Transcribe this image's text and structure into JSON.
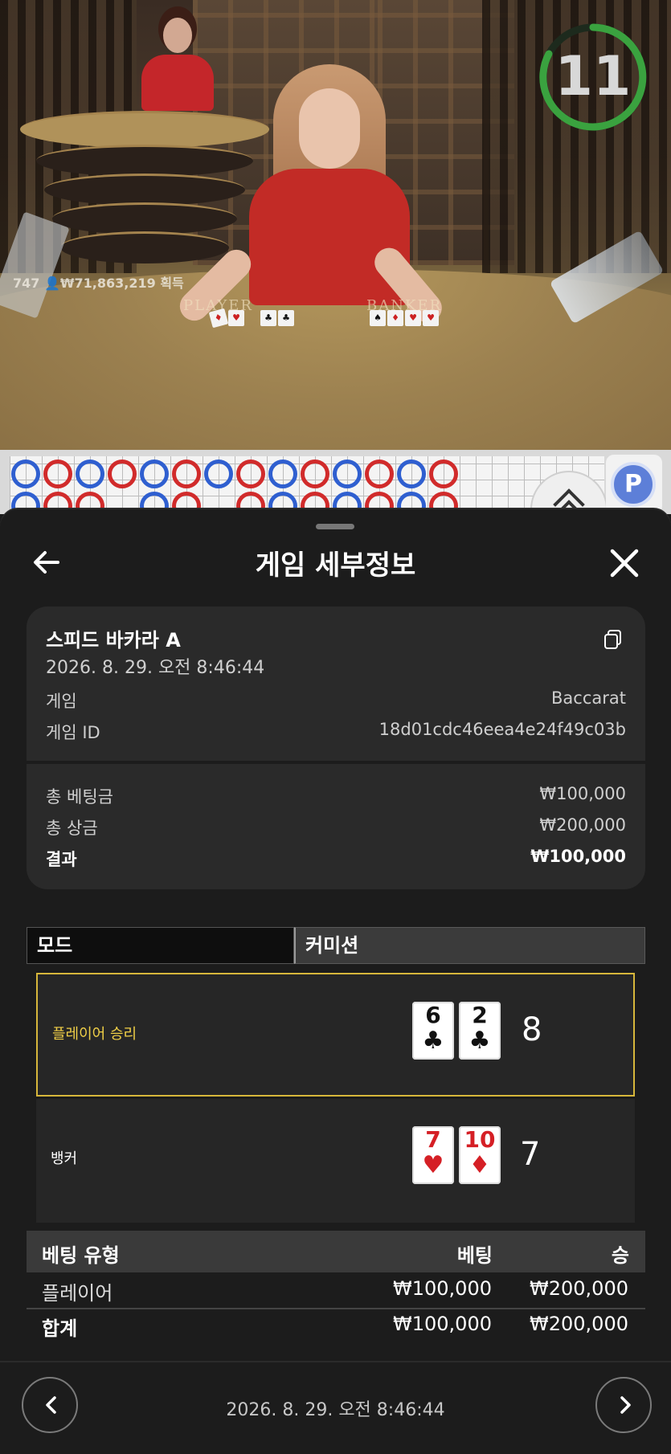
{
  "video": {
    "timer": "11",
    "overlay_stat": "747 👤₩71,863,219 획득",
    "felt_player": "PLAYER",
    "felt_banker": "BANKER"
  },
  "sheet": {
    "title": "게임 세부정보",
    "summary": {
      "game_name": "스피드 바카라 A",
      "datetime": "2026. 8. 29. 오전 8:46:44",
      "game_label": "게임",
      "game_value": "Baccarat",
      "game_id_label": "게임 ID",
      "game_id_value": "18d01cdc46eea4e24f49c03b",
      "total_bet_label": "총 베팅금",
      "total_bet_value": "₩100,000",
      "total_win_label": "총 상금",
      "total_win_value": "₩200,000",
      "result_label": "결과",
      "result_value": "₩100,000"
    },
    "tabs": {
      "mode": "모드",
      "commission": "커미션"
    },
    "hands": [
      {
        "label": "플레이어 승리",
        "cards": [
          {
            "rank": "6",
            "suit": "♣"
          },
          {
            "rank": "2",
            "suit": "♣"
          }
        ],
        "score": "8",
        "winner": true
      },
      {
        "label": "뱅커",
        "cards": [
          {
            "rank": "7",
            "suit": "♥"
          },
          {
            "rank": "10",
            "suit": "♦"
          }
        ],
        "score": "7",
        "winner": false
      }
    ],
    "bets": {
      "headers": [
        "베팅 유형",
        "베팅",
        "승"
      ],
      "rows": [
        {
          "type": "플레이어",
          "bet": "₩100,000",
          "win": "₩200,000"
        }
      ],
      "total": {
        "type": "합계",
        "bet": "₩100,000",
        "win": "₩200,000"
      }
    },
    "footer_date": "2026. 8. 29. 오전 8:46:44"
  },
  "colors": {
    "winner_border": "#d7b73b",
    "winner_label": "#f0cf47",
    "timer_ring": "#3aa23f",
    "player_bead": "#2f5fd0",
    "banker_bead": "#d12b2b"
  }
}
